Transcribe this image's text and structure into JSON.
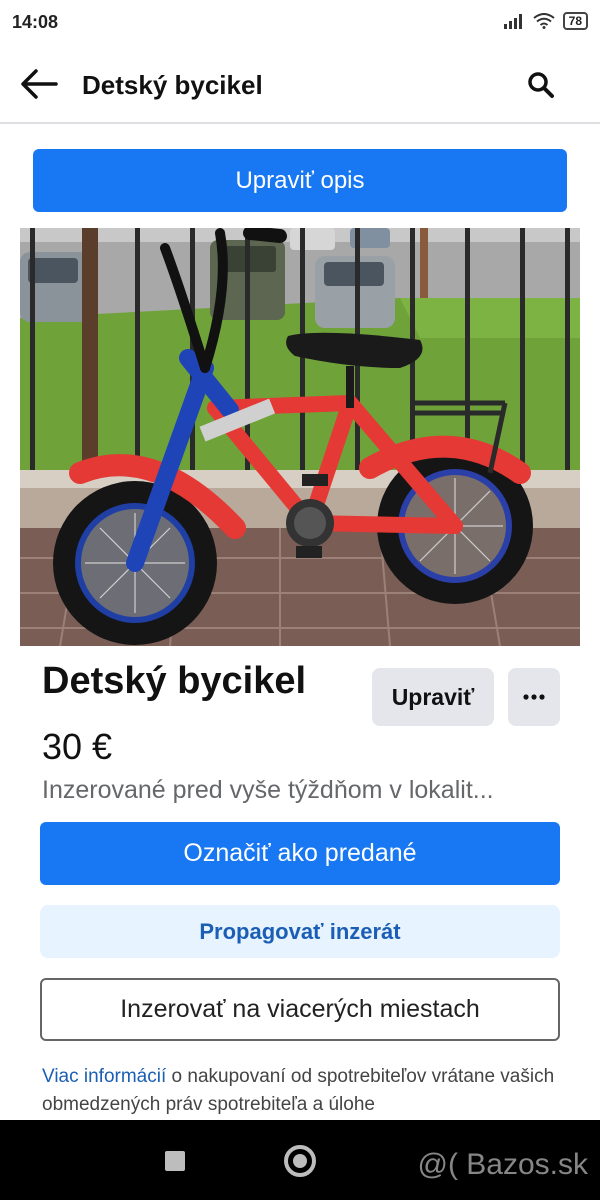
{
  "status_bar": {
    "time": "14:08",
    "battery": "78"
  },
  "header": {
    "title": "Detský bycikel"
  },
  "edit_description_label": "Upraviť opis",
  "listing": {
    "title": "Detský bycikel",
    "price": "30 €",
    "listed": "Inzerované pred vyše týždňom v lokalit...",
    "edit_label": "Upraviť",
    "more_label": "···"
  },
  "actions": {
    "mark_sold": "Označiť ako predané",
    "promote": "Propagovať inzerát",
    "list_multiple": "Inzerovať na viacerých miestach"
  },
  "info": {
    "link": "Viac informácií",
    "text": " o nakupovaní od spotrebiteľov vrátane vašich obmedzených práv spotrebiteľa a úlohe"
  },
  "watermark": "@( Bazos.sk",
  "colors": {
    "primary": "#1877f2",
    "promote_bg": "#e7f3ff",
    "secondary_bg": "#e4e6eb"
  }
}
